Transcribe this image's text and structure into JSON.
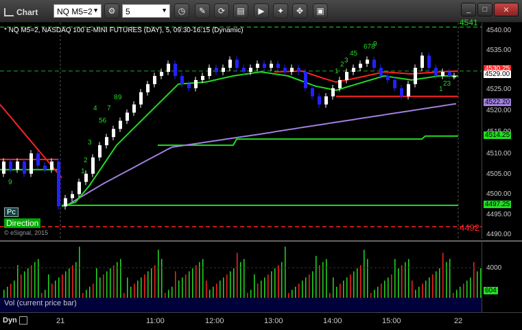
{
  "app": {
    "title": "Chart"
  },
  "toolbar": {
    "symbol": "NQ M5=2",
    "interval": "5",
    "tools": [
      "settings-icon",
      "clock-icon",
      "pencil-icon",
      "cycle-icon",
      "data-icon",
      "play-icon",
      "wrench-icon",
      "image-icon"
    ]
  },
  "window": {
    "min": "_",
    "max": "□",
    "close": "✕"
  },
  "study_title": "* NQ M5=2, NASDAQ 100 E-MINI FUTURES (DAY), 5, 09:30-16:15 (Dynamic)",
  "overlays": {
    "pc": "Pc",
    "direction": "Direction",
    "copyright": "© eSignal, 2015"
  },
  "volume": {
    "label": "Vol (current price bar)",
    "axis": "4000",
    "tag": "604"
  },
  "time_axis": {
    "dyn": "Dyn",
    "labels": [
      "21",
      "11:00",
      "12:00",
      "13:00",
      "14:00",
      "15:00",
      "22"
    ]
  },
  "price_axis": {
    "labels": [
      "4540.00",
      "4535.00",
      "4530.00",
      "4525.00",
      "4520.00",
      "4515.00",
      "4510.00",
      "4505.00",
      "4500.00",
      "4495.00",
      "4490.00"
    ],
    "tags": {
      "last": "4529.00",
      "red": "4530.25",
      "purple": "4522.20",
      "green1": "4514.25",
      "green2": "4497.25"
    },
    "hi_marker": "4541",
    "lo_marker": "4492"
  },
  "counts": [
    {
      "t": "9",
      "c": "green"
    },
    {
      "t": "1",
      "c": "green"
    },
    {
      "t": "2",
      "c": "green"
    },
    {
      "t": "3",
      "c": "green"
    },
    {
      "t": "4",
      "c": "green"
    },
    {
      "t": "56",
      "c": "green"
    },
    {
      "t": "7",
      "c": "green"
    },
    {
      "t": "8",
      "c": "green"
    },
    {
      "t": "9",
      "c": "green"
    },
    {
      "t": "1",
      "c": "green"
    },
    {
      "t": "2",
      "c": "green"
    },
    {
      "t": "3",
      "c": "green"
    },
    {
      "t": "45",
      "c": "green"
    },
    {
      "t": "678",
      "c": "green"
    },
    {
      "t": "9",
      "c": "green"
    },
    {
      "t": "1",
      "c": "green"
    },
    {
      "t": "23",
      "c": "green"
    }
  ],
  "colors": {
    "up": "#ffffff",
    "down": "#2222ff",
    "green": "#22dd22",
    "red": "#ff2222",
    "purple": "#a080e0"
  }
}
